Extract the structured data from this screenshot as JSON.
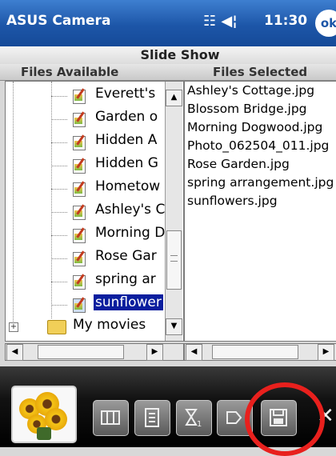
{
  "titlebar": {
    "app_title": "ASUS Camera",
    "status_icons": "☷ ◀¦",
    "clock": "11:30",
    "ok_label": "ok"
  },
  "slideshow": {
    "title": "Slide Show"
  },
  "columns": {
    "left": "Files Available",
    "right": "Files Selected"
  },
  "files_available": [
    {
      "name": "Everett's",
      "selected": false
    },
    {
      "name": "Garden o",
      "selected": false
    },
    {
      "name": "Hidden A",
      "selected": false
    },
    {
      "name": "Hidden G",
      "selected": false
    },
    {
      "name": "Hometow",
      "selected": false
    },
    {
      "name": "Ashley's C",
      "selected": false
    },
    {
      "name": "Morning D",
      "selected": false
    },
    {
      "name": "Rose Gar",
      "selected": false
    },
    {
      "name": "spring ar",
      "selected": false
    },
    {
      "name": "sunflower",
      "selected": true
    }
  ],
  "folder": {
    "name": "My movies",
    "expander": "+"
  },
  "files_selected": [
    "Ashley's Cottage.jpg",
    "Blossom Bridge.jpg",
    "Morning Dogwood.jpg",
    "Photo_062504_011.jpg",
    "Rose Garden.jpg",
    "spring arrangement.jpg",
    "sunflowers.jpg"
  ],
  "scroll": {
    "up": "▲",
    "down": "▼",
    "left": "◀",
    "right": "▶"
  },
  "toolbar": {
    "close": "✕"
  },
  "colors": {
    "title_bar": "#1d56a8",
    "selection": "#0a1e9e",
    "highlight_ring": "#e8201d"
  }
}
